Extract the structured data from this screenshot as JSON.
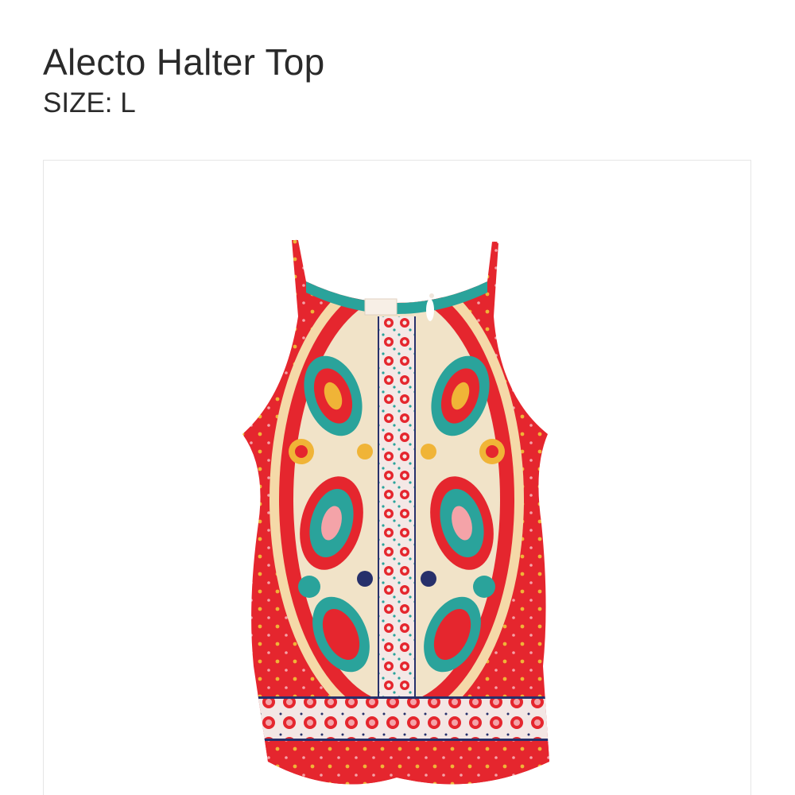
{
  "product": {
    "name": "Alecto Halter Top",
    "size_label": "SIZE:",
    "size_value": "L"
  },
  "image": {
    "icon": "halter-top-image",
    "colors": {
      "base": "#e5262e",
      "teal": "#2aa39b",
      "cream": "#f1e3c8",
      "gold": "#f0b437",
      "pink": "#f4a3a8",
      "navy": "#27306b"
    }
  }
}
